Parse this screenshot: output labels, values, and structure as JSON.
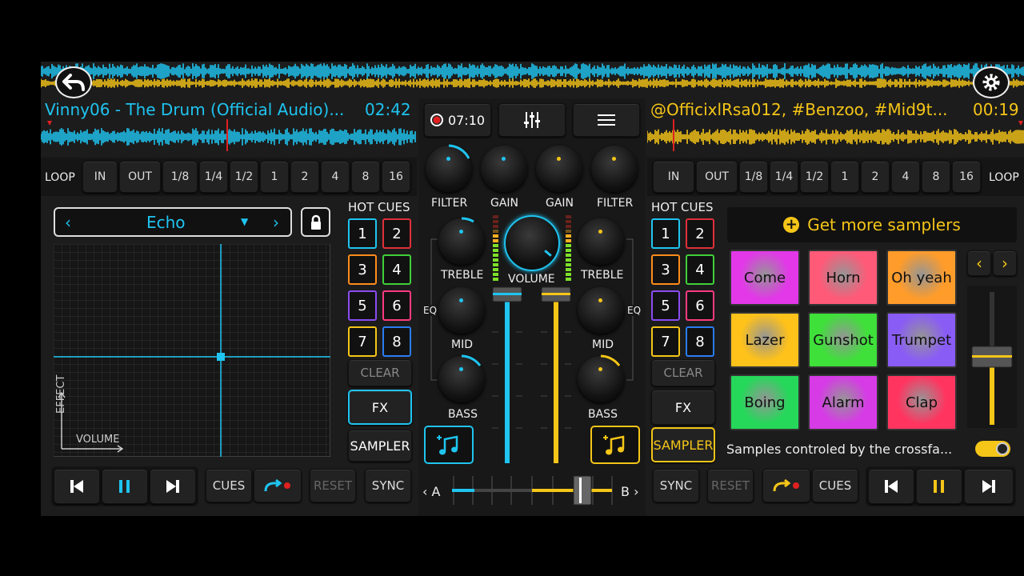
{
  "deck_a": {
    "title": "Vinny06 - The Drum (Official Audio)...",
    "time": "02:42",
    "loop_label": "LOOP",
    "loop_buttons": [
      "IN",
      "OUT",
      "1/8",
      "1/4",
      "1/2",
      "1",
      "2",
      "4",
      "8",
      "16"
    ],
    "effect": {
      "name": "Echo",
      "y_axis": "EFFECT",
      "x_axis": "VOLUME"
    },
    "hot_cues_label": "HOT CUES",
    "cues": [
      "1",
      "2",
      "3",
      "4",
      "5",
      "6",
      "7",
      "8"
    ],
    "clear": "CLEAR",
    "fx": "FX",
    "sampler": "SAMPLER",
    "transport": {
      "cues": "CUES",
      "reset": "RESET",
      "sync": "SYNC"
    },
    "accent": "#1fc4f0"
  },
  "deck_b": {
    "title": "@OfficixlRsa012, #Benzoo, #Mid9t...",
    "time": "00:19",
    "loop_label": "LOOP",
    "loop_buttons": [
      "IN",
      "OUT",
      "1/8",
      "1/4",
      "1/2",
      "1",
      "2",
      "4",
      "8",
      "16"
    ],
    "hot_cues_label": "HOT CUES",
    "cues": [
      "1",
      "2",
      "3",
      "4",
      "5",
      "6",
      "7",
      "8"
    ],
    "clear": "CLEAR",
    "fx": "FX",
    "sampler": "SAMPLER",
    "transport": {
      "cues": "CUES",
      "reset": "RESET",
      "sync": "SYNC"
    },
    "accent": "#f5c518"
  },
  "mixer": {
    "record_time": "07:10",
    "filter_a": "FILTER",
    "gain_a": "GAIN",
    "gain_b": "GAIN",
    "filter_b": "FILTER",
    "treble_a": "TREBLE",
    "treble_b": "TREBLE",
    "volume": "VOLUME",
    "eq_a": "EQ",
    "eq_b": "EQ",
    "mid_a": "MID",
    "mid_b": "MID",
    "bass_a": "BASS",
    "bass_b": "BASS",
    "cross_a": "A",
    "cross_b": "B"
  },
  "sampler": {
    "get_more": "Get more samplers",
    "pads": [
      {
        "label": "Come",
        "color": "#e238e8"
      },
      {
        "label": "Horn",
        "color": "#ff5a78"
      },
      {
        "label": "Oh yeah",
        "color": "#ff9c2a"
      },
      {
        "label": "Lazer",
        "color": "#ffc21a"
      },
      {
        "label": "Gunshot",
        "color": "#3fe03a"
      },
      {
        "label": "Trumpet",
        "color": "#8a5cf6"
      },
      {
        "label": "Boing",
        "color": "#25d85a"
      },
      {
        "label": "Alarm",
        "color": "#d63be6"
      },
      {
        "label": "Clap",
        "color": "#ff3560"
      }
    ],
    "footer": "Samples controled by the crossfa..."
  },
  "icons": [
    "back-arrow-icon",
    "gear-icon",
    "record-icon",
    "equalizer-icon",
    "menu-icon",
    "lock-icon",
    "music-note-icon",
    "skip-back-icon",
    "pause-icon",
    "skip-forward-icon",
    "loop-icon"
  ]
}
